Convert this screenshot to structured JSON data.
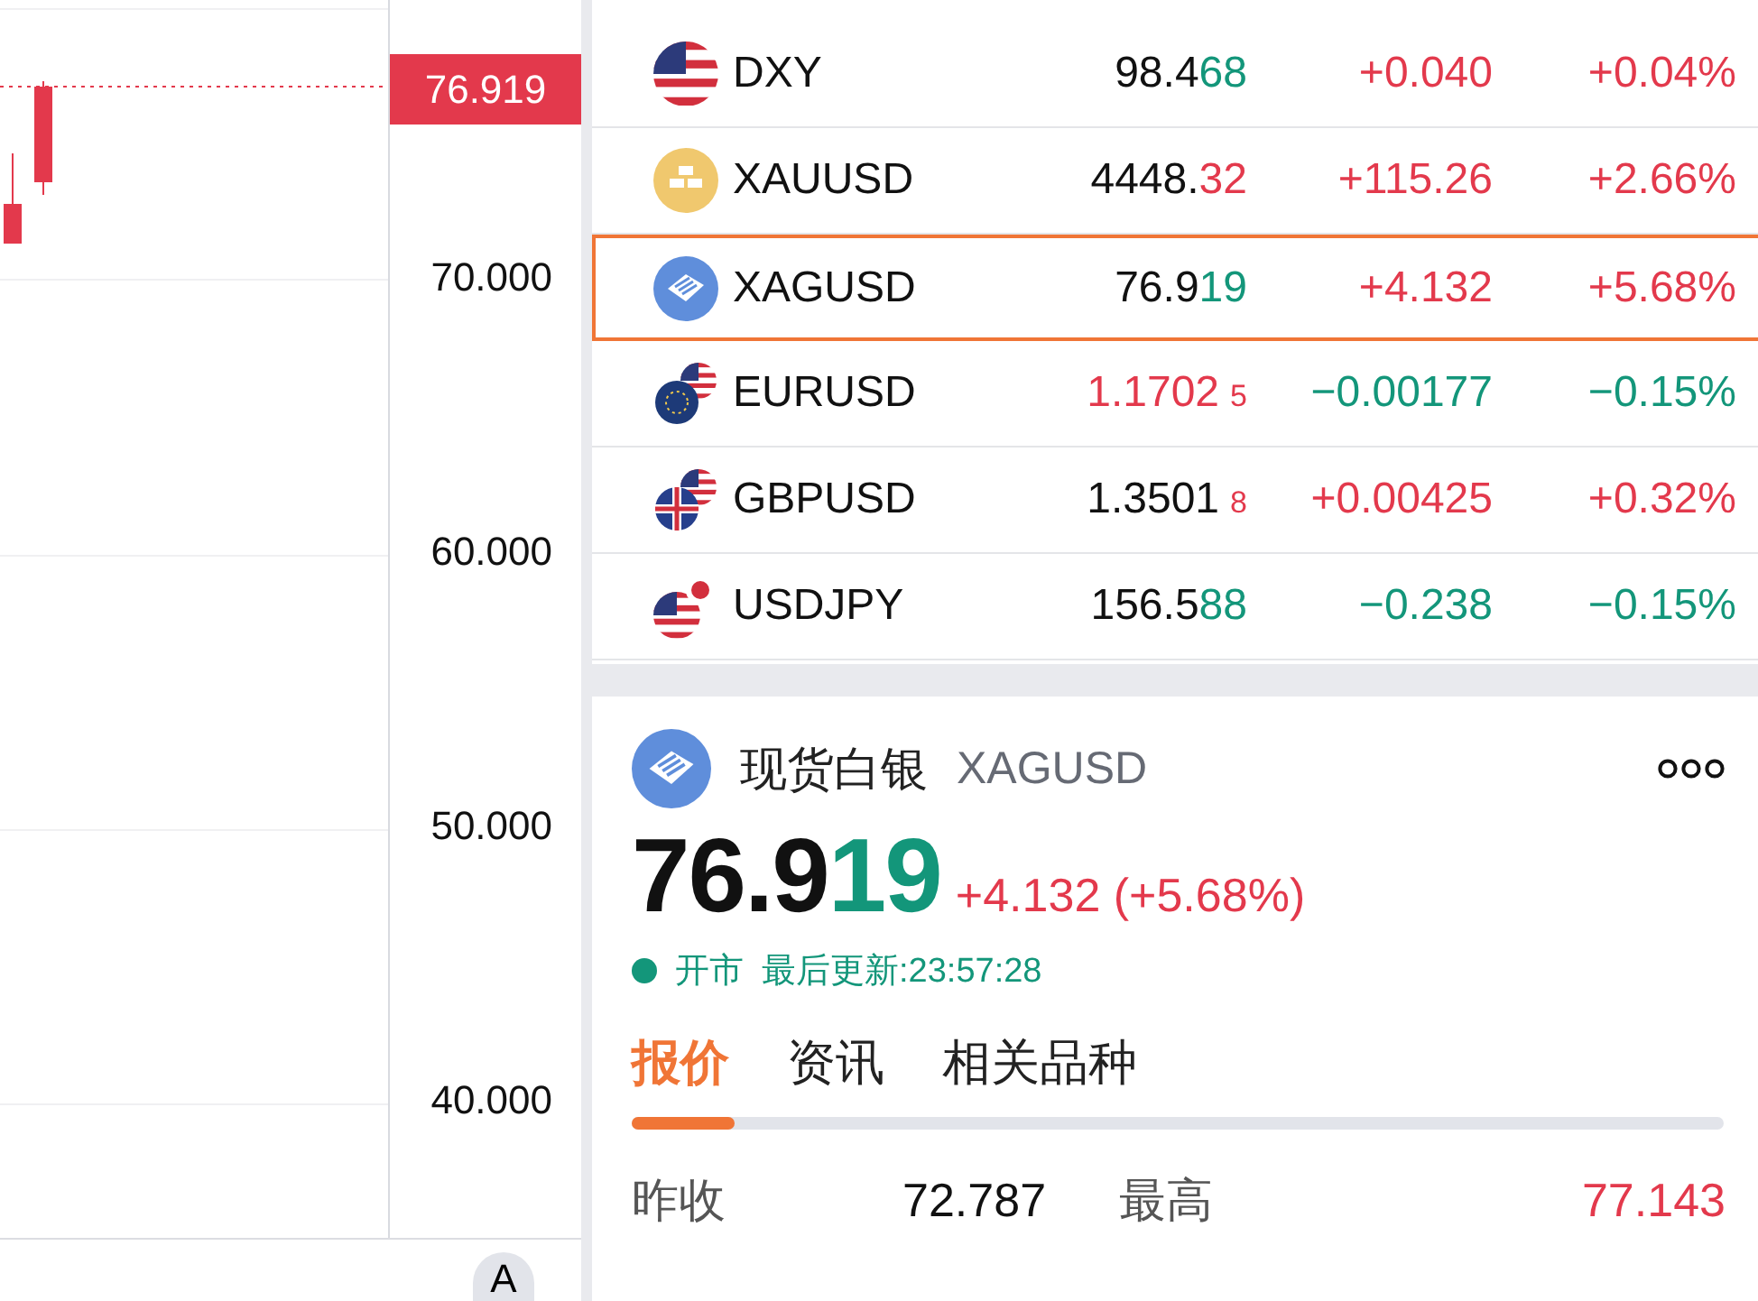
{
  "chart": {
    "current_price": "76.919",
    "axis_labels": [
      "70.000",
      "60.000",
      "50.000",
      "40.000"
    ],
    "corner_badge": "A"
  },
  "watchlist": [
    {
      "symbol": "DXY",
      "price_main": "98.4",
      "price_tail": "68",
      "main_highlighted": false,
      "tail_up": false,
      "tail_small": false,
      "change": "+0.040",
      "change_up": true,
      "percent": "+0.04%",
      "selected": false
    },
    {
      "symbol": "XAUUSD",
      "price_main": "4448.",
      "price_tail": "32",
      "main_highlighted": false,
      "tail_up": true,
      "tail_small": false,
      "change": "+115.26",
      "change_up": true,
      "percent": "+2.66%",
      "selected": false
    },
    {
      "symbol": "XAGUSD",
      "price_main": "76.9",
      "price_tail": "19",
      "main_highlighted": false,
      "tail_up": false,
      "tail_small": false,
      "change": "+4.132",
      "change_up": true,
      "percent": "+5.68%",
      "selected": true
    },
    {
      "symbol": "EURUSD",
      "price_main": "1.1702",
      "price_tail": "5",
      "main_highlighted": true,
      "tail_up": true,
      "tail_small": true,
      "change": "−0.00177",
      "change_up": false,
      "percent": "−0.15%",
      "selected": false
    },
    {
      "symbol": "GBPUSD",
      "price_main": "1.3501",
      "price_tail": "8",
      "main_highlighted": false,
      "tail_up": true,
      "tail_small": true,
      "change": "+0.00425",
      "change_up": true,
      "percent": "+0.32%",
      "selected": false
    },
    {
      "symbol": "USDJPY",
      "price_main": "156.5",
      "price_tail": "88",
      "main_highlighted": false,
      "tail_up": false,
      "tail_small": false,
      "change": "−0.238",
      "change_up": false,
      "percent": "−0.15%",
      "selected": false
    }
  ],
  "detail": {
    "name": "现货白银",
    "symbol": "XAGUSD",
    "price_main": "76.9",
    "price_tail": "19",
    "change": "+4.132 (+5.68%)",
    "market_status": "开市",
    "last_update": "最后更新:23:57:28",
    "tabs": [
      {
        "label": "报价",
        "selected": true
      },
      {
        "label": "资讯",
        "selected": false
      },
      {
        "label": "相关品种",
        "selected": false
      }
    ],
    "stats": [
      {
        "label": "昨收",
        "value": "72.787",
        "highlighted": false
      },
      {
        "label": "最高",
        "value": "77.143",
        "highlighted": true
      }
    ]
  }
}
